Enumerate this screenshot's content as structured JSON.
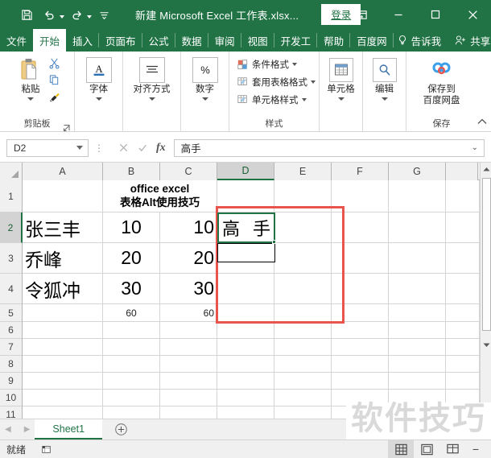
{
  "titlebar": {
    "quick_access": [
      {
        "name": "save-icon",
        "label": "保存"
      },
      {
        "name": "undo-icon",
        "label": "撤销"
      },
      {
        "name": "redo-icon",
        "label": "恢复"
      },
      {
        "name": "customize-qat-icon",
        "label": "自定义快速访问工具栏"
      }
    ],
    "document_title": "新建 Microsoft Excel 工作表.xlsx...",
    "signin_label": "登录",
    "ribbon_display_label": "功能区显示选项",
    "minimize_label": "最小化",
    "maximize_label": "最大化",
    "close_label": "关闭"
  },
  "ribbon": {
    "tabs": [
      {
        "label": "文件",
        "active": false
      },
      {
        "label": "开始",
        "active": true
      },
      {
        "label": "插入",
        "active": false
      },
      {
        "label": "页面布",
        "active": false
      },
      {
        "label": "公式",
        "active": false
      },
      {
        "label": "数据",
        "active": false
      },
      {
        "label": "审阅",
        "active": false
      },
      {
        "label": "视图",
        "active": false
      },
      {
        "label": "开发工",
        "active": false
      },
      {
        "label": "帮助",
        "active": false
      },
      {
        "label": "百度网",
        "active": false
      }
    ],
    "tell_me_label": "告诉我",
    "share_label": "共享",
    "groups": {
      "clipboard": {
        "paste_label": "粘贴",
        "cut_label": "剪切",
        "copy_label": "复制",
        "format_painter_label": "格式刷",
        "group_label": "剪贴板"
      },
      "font": {
        "label": "字体"
      },
      "alignment": {
        "label": "对齐方式"
      },
      "number": {
        "label": "数字"
      },
      "styles": {
        "conditional_formatting": "条件格式",
        "format_as_table": "套用表格格式",
        "cell_styles": "单元格样式",
        "group_label": "样式"
      },
      "cells": {
        "label": "单元格"
      },
      "editing": {
        "label": "编辑"
      },
      "save": {
        "baidu_label_line1": "保存到",
        "baidu_label_line2": "百度网盘",
        "group_label": "保存"
      }
    }
  },
  "formula_bar": {
    "name_box_value": "D2",
    "cancel_label": "取消",
    "enter_label": "输入",
    "fx_label": "插入函数",
    "formula_value": "高手"
  },
  "grid": {
    "columns": [
      "A",
      "B",
      "C",
      "D",
      "E",
      "F",
      "G"
    ],
    "selected_column": "D",
    "rows": [
      "1",
      "2",
      "3",
      "4",
      "5",
      "6",
      "7",
      "8",
      "9",
      "10",
      "11"
    ],
    "selected_row": "2",
    "active_cell": "D2",
    "active_cell_display": [
      "高",
      "手"
    ],
    "cells": [
      {
        "ref": "B1",
        "value": "office excel",
        "line2": "表格Alt使用技巧",
        "style": "title",
        "align": "center"
      },
      {
        "ref": "A2",
        "value": "张三丰",
        "style": "big",
        "align": "left"
      },
      {
        "ref": "B2",
        "value": "10",
        "style": "big",
        "align": "center"
      },
      {
        "ref": "C2",
        "value": "10",
        "style": "big",
        "align": "right"
      },
      {
        "ref": "A3",
        "value": "乔峰",
        "style": "big",
        "align": "left"
      },
      {
        "ref": "B3",
        "value": "20",
        "style": "big",
        "align": "center"
      },
      {
        "ref": "C3",
        "value": "20",
        "style": "big",
        "align": "right"
      },
      {
        "ref": "A4",
        "value": "令狐冲",
        "style": "big",
        "align": "left"
      },
      {
        "ref": "B4",
        "value": "30",
        "style": "big",
        "align": "center"
      },
      {
        "ref": "C4",
        "value": "30",
        "style": "big",
        "align": "right"
      },
      {
        "ref": "B5",
        "value": "60",
        "style": "small",
        "align": "center"
      },
      {
        "ref": "C5",
        "value": "60",
        "style": "small",
        "align": "right"
      }
    ]
  },
  "sheetbar": {
    "prev_label": "上一张",
    "next_label": "下一张",
    "tabs": [
      {
        "label": "Sheet1",
        "active": true
      }
    ],
    "add_sheet_label": "新建工作表"
  },
  "statusbar": {
    "status_text": "就绪",
    "macro_record_label": "录制宏",
    "views": [
      {
        "name": "normal-view-icon",
        "label": "普通",
        "active": true
      },
      {
        "name": "page-layout-view-icon",
        "label": "页面布局",
        "active": false
      },
      {
        "name": "page-break-view-icon",
        "label": "分页预览",
        "active": false
      }
    ],
    "zoom_out_label": "缩小"
  },
  "watermark": {
    "text": "软件技巧"
  },
  "colors": {
    "excel_green": "#217346",
    "annotation_red": "#e8554d",
    "selection_green": "#217346",
    "watermark_gray": "#d9d9d9"
  }
}
